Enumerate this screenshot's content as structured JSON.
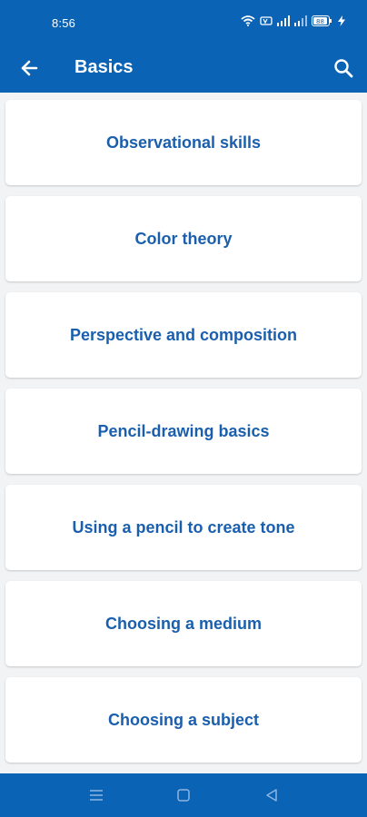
{
  "status_bar": {
    "time": "8:56",
    "battery_level": "88"
  },
  "app_bar": {
    "title": "Basics",
    "back_icon": "arrow-left-icon",
    "search_icon": "search-icon"
  },
  "topics": [
    {
      "label": "Observational skills"
    },
    {
      "label": "Color theory"
    },
    {
      "label": "Perspective and composition"
    },
    {
      "label": "Pencil-drawing basics"
    },
    {
      "label": "Using a pencil to create tone"
    },
    {
      "label": "Choosing a medium"
    },
    {
      "label": "Choosing a subject"
    }
  ],
  "nav_bar": {
    "icons": [
      "menu-icon",
      "home-icon",
      "back-triangle-icon"
    ]
  },
  "colors": {
    "primary": "#0b63b6",
    "card_text": "#1a5fae",
    "background": "#f1f3f5",
    "card": "#ffffff"
  }
}
